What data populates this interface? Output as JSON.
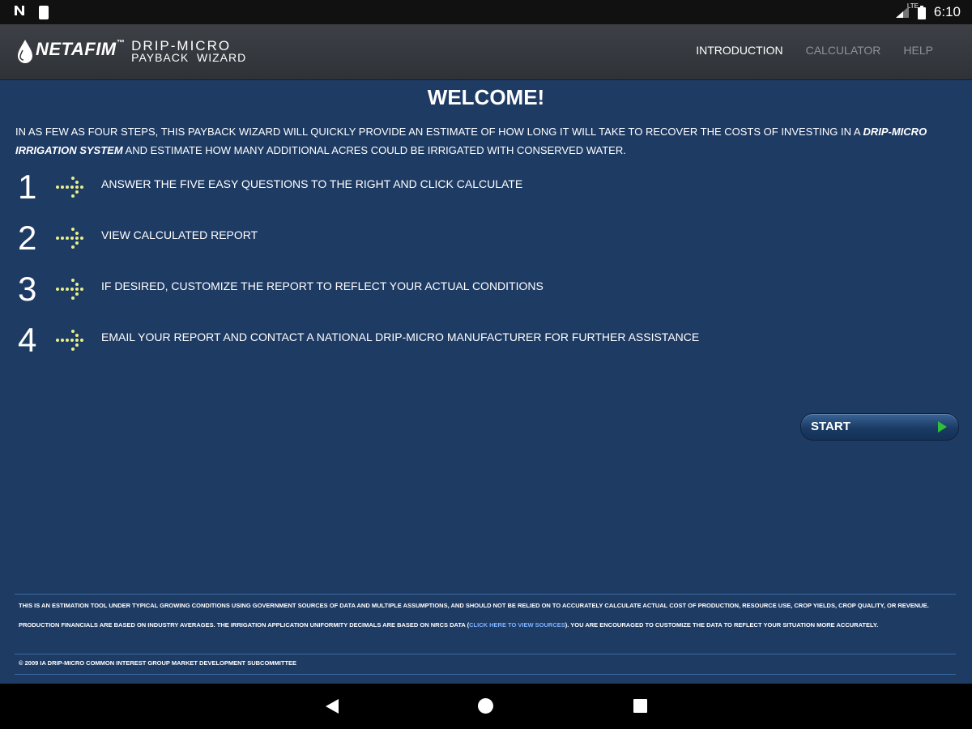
{
  "status_bar": {
    "network_label": "LTE",
    "time": "6:10"
  },
  "header": {
    "brand": "NETAFIM",
    "brand_tm": "™",
    "product_line1": "DRIP-MICRO",
    "product_line2": "PAYBACK  WIZARD",
    "nav": [
      {
        "label": "INTRODUCTION",
        "active": true
      },
      {
        "label": "CALCULATOR",
        "active": false
      },
      {
        "label": "HELP",
        "active": false
      }
    ]
  },
  "main": {
    "title": "WELCOME!",
    "intro_part1": "In as few as four steps, this payback wizard will quickly provide an estimate of how long it will take to recover the costs of investing in a ",
    "intro_emphasis": "drip-micro irrigation system",
    "intro_part2": " and estimate how many additional acres could be irrigated with conserved water.",
    "steps": [
      {
        "number": "1",
        "text": "ANSWER THE FIVE EASY QUESTIONS TO THE RIGHT AND CLICK CALCULATE"
      },
      {
        "number": "2",
        "text": "VIEW CALCULATED REPORT"
      },
      {
        "number": "3",
        "text": "IF DESIRED, CUSTOMIZE THE REPORT TO REFLECT YOUR ACTUAL CONDITIONS"
      },
      {
        "number": "4",
        "text": "EMAIL YOUR REPORT AND CONTACT A NATIONAL DRIP-MICRO MANUFACTURER FOR FURTHER ASSISTANCE"
      }
    ],
    "start_label": "START",
    "disclaimer_part1": "This is an estimation tool under typical growing conditions using government sources of data and multiple assumptions, and should not be relied on to accurately calculate actual cost of production, resource use, crop yields, crop quality, or revenue. Production financials are based on industry averages. The irrigation application uniformity decimals are based on NRCS data (",
    "disclaimer_link": "click here to view sources",
    "disclaimer_part2": "). You are encouraged to customize the data to reflect your situation more accurately.",
    "copyright": "© 2009 IA Drip-Micro Common Interest Group Market Development Subcommittee"
  },
  "colors": {
    "background": "#1e3b64",
    "header": "#35383d",
    "arrow": "#e6ef8a",
    "start_play": "#2fbf3a"
  }
}
